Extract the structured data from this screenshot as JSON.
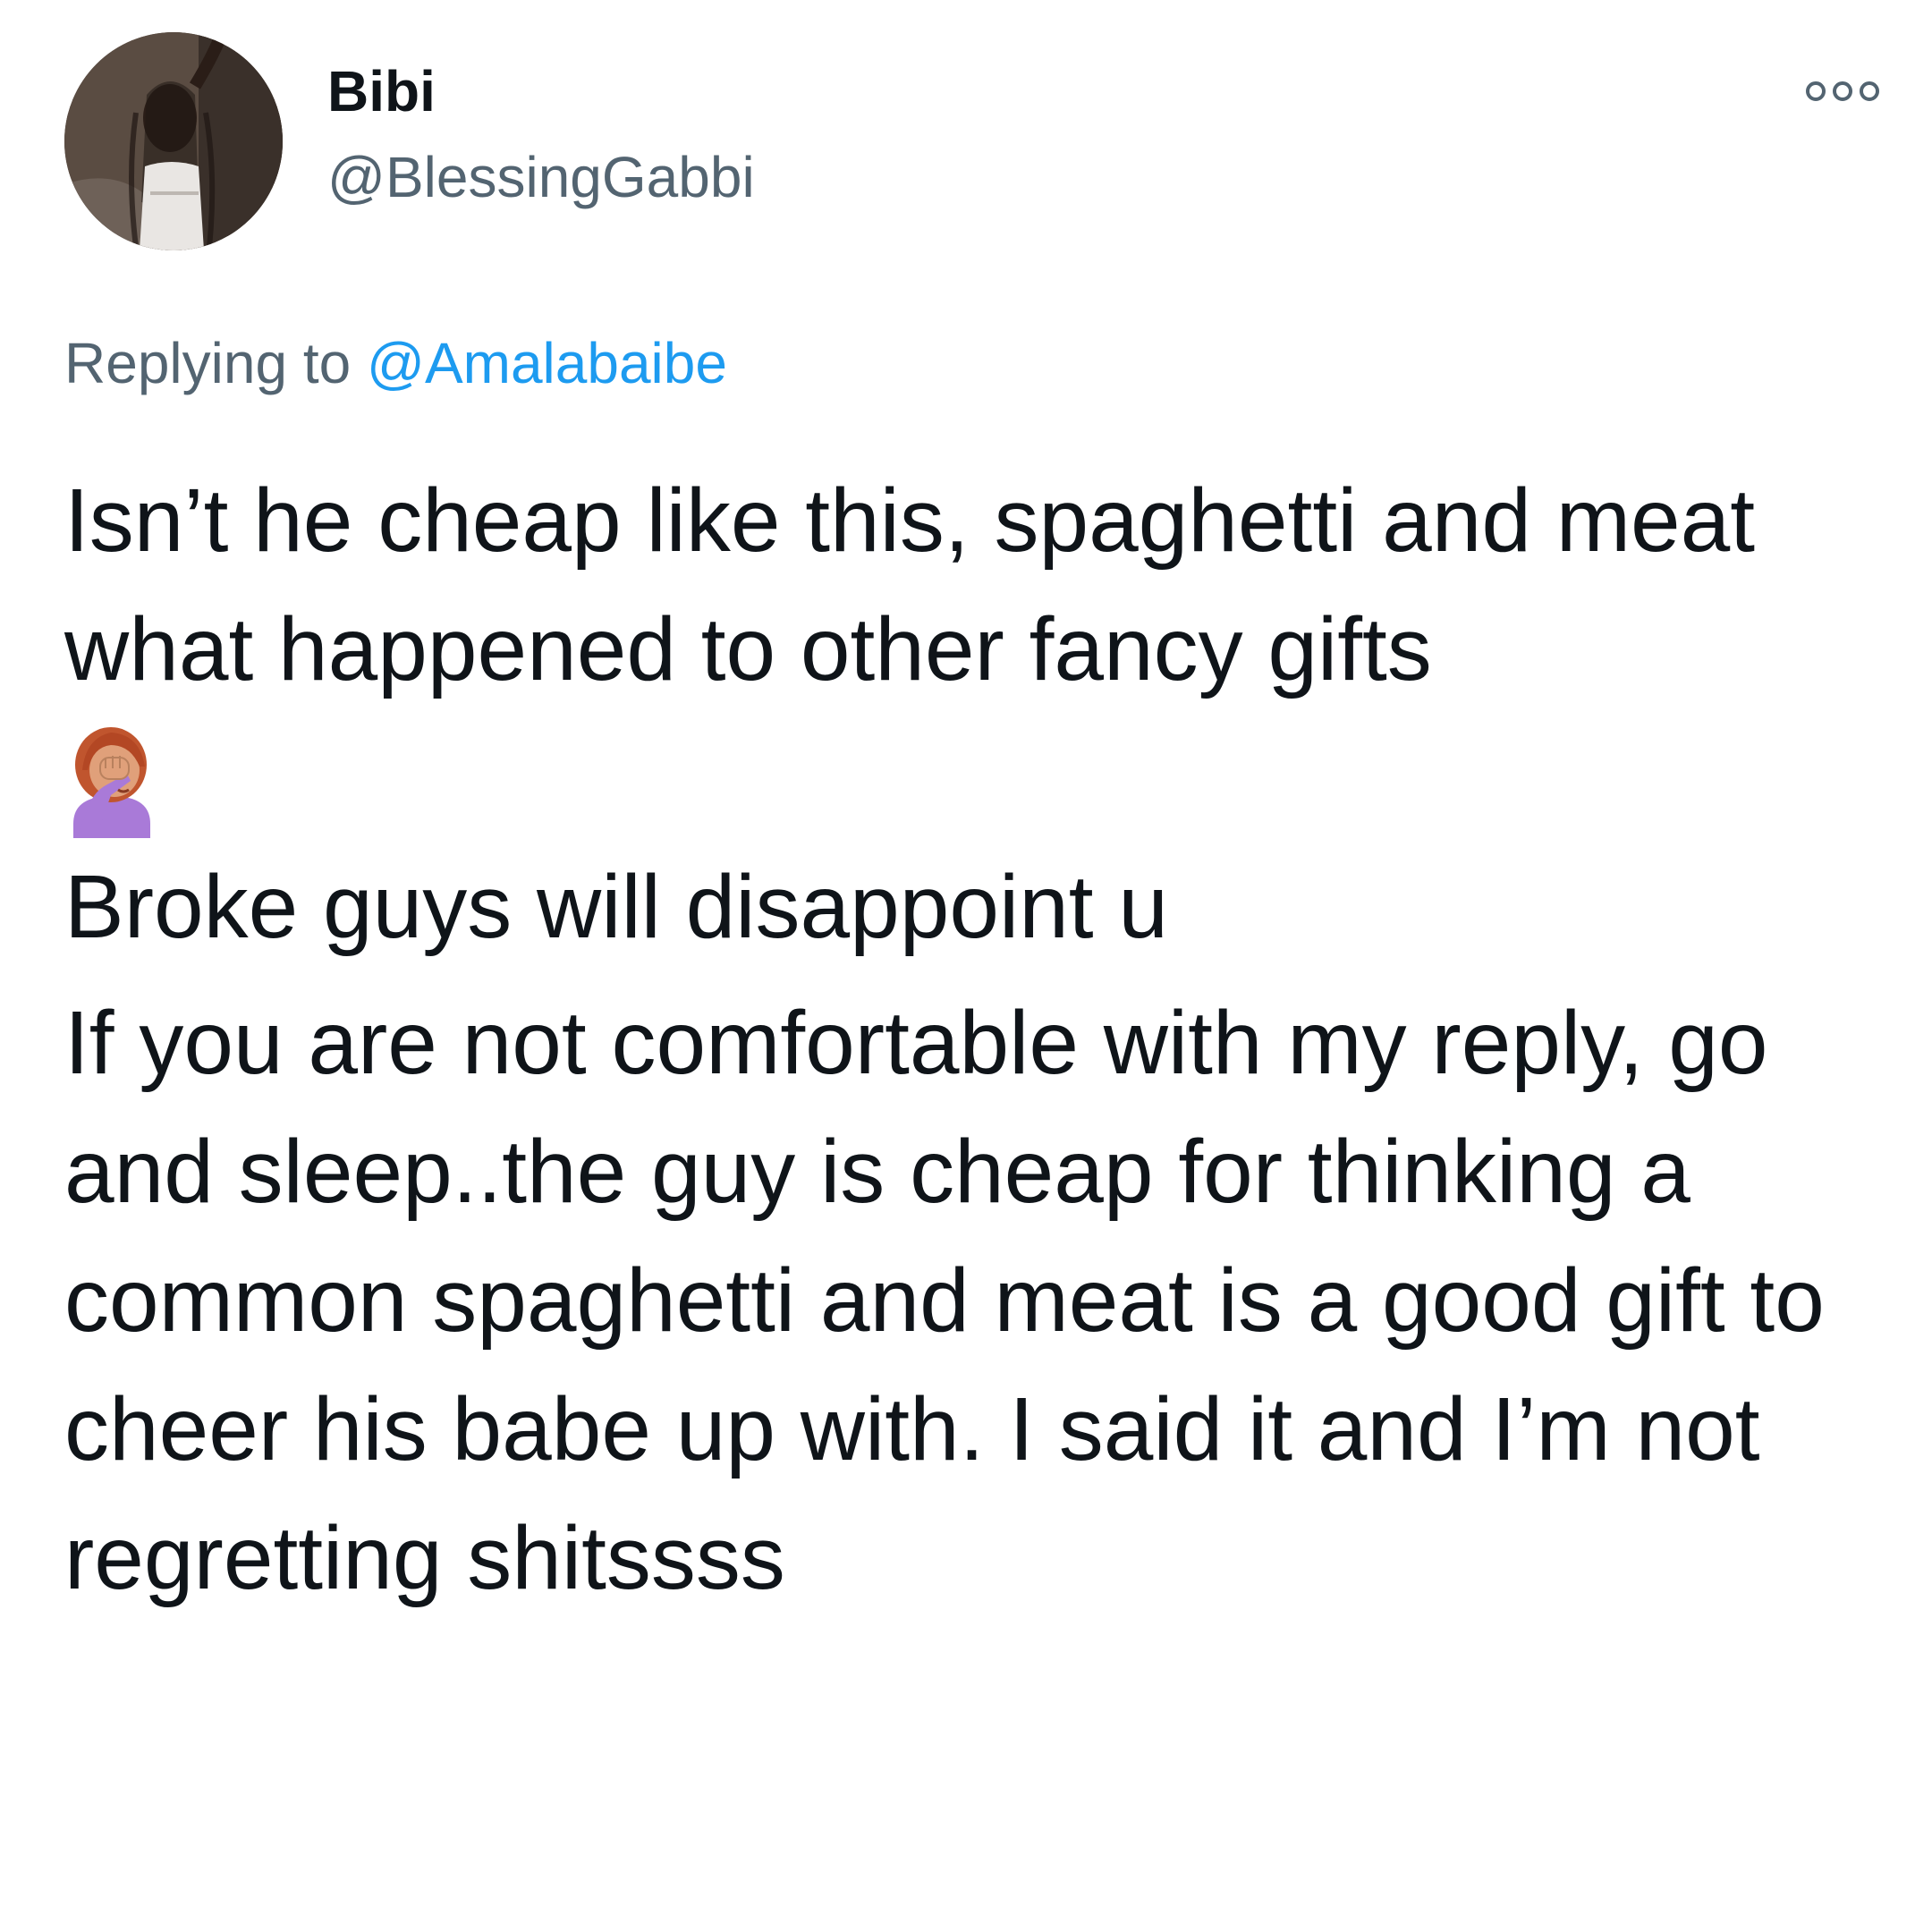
{
  "tweet": {
    "author": {
      "display_name": "Bibi",
      "handle": "@BlessingGabbi",
      "avatar_icon": "profile-photo"
    },
    "more_icon": "more-options-icon",
    "reply_context": {
      "prefix": "Replying to ",
      "mention": "@Amalabaibe"
    },
    "body": {
      "line1": "Isn’t he cheap like this, spaghetti and meat what happened to other fancy gifts",
      "emoji": "woman-facepalming-emoji",
      "line2": "Broke guys will disappoint u",
      "line3": "If you are not comfortable with my reply, go and sleep..the guy is cheap for thinking a common spaghetti and meat is a good gift to cheer his babe up with. I said it and I’m not regretting shitssss"
    }
  },
  "colors": {
    "text_primary": "#0f1419",
    "text_secondary": "#536471",
    "link": "#1d9bf0",
    "background": "#ffffff"
  }
}
